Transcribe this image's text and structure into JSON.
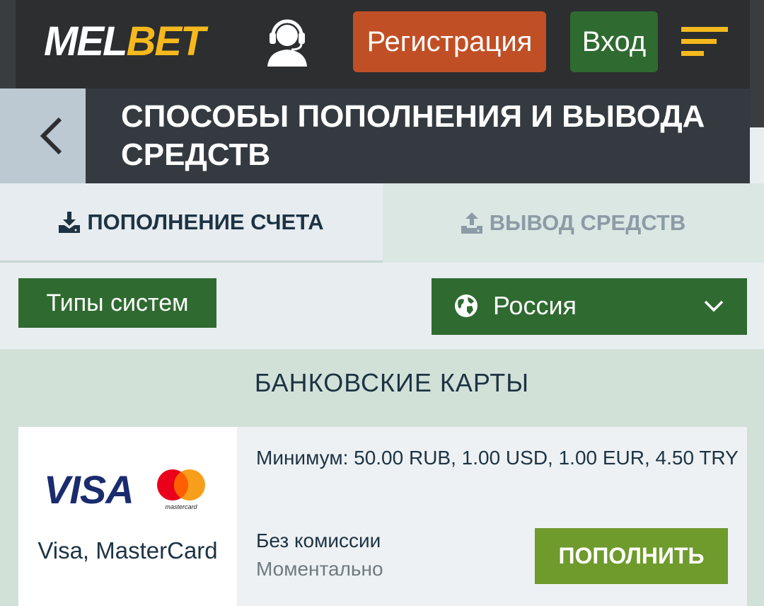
{
  "header": {
    "logo_part1": "MEL",
    "logo_part2": "BET",
    "support_icon": "support-headset-icon",
    "register_label": "Регистрация",
    "login_label": "Вход",
    "menu_icon": "menu-icon"
  },
  "title_bar": {
    "title": "СПОСОБЫ ПОПОЛНЕНИЯ И ВЫВОДА СРЕДСТВ",
    "back_icon": "chevron-left-icon"
  },
  "tabs": [
    {
      "label": "ПОПОЛНЕНИЕ СЧЕТА",
      "icon": "download-icon",
      "active": true
    },
    {
      "label": "ВЫВОД СРЕДСТВ",
      "icon": "upload-icon",
      "active": false
    }
  ],
  "filters": {
    "types_label": "Типы систем",
    "country_selected": "Россия",
    "country_icon": "globe-icon"
  },
  "section": {
    "title": "БАНКОВСКИЕ КАРТЫ",
    "methods": [
      {
        "logo_text": "VISA",
        "mc_logo_text": "mastercard",
        "name": "Visa, MasterCard",
        "minimum": "Минимум: 50.00 RUB, 1.00 USD, 1.00 EUR, 4.50 TRY",
        "fee": "Без комиссии",
        "speed": "Моментально",
        "button_label": "ПОПОЛНИТЬ"
      }
    ]
  },
  "colors": {
    "header_bg": "#2c2e30",
    "register": "#c14f25",
    "green": "#2f6a30",
    "deposit_button": "#6f9a2c",
    "logo_yellow": "#f5b91d"
  }
}
